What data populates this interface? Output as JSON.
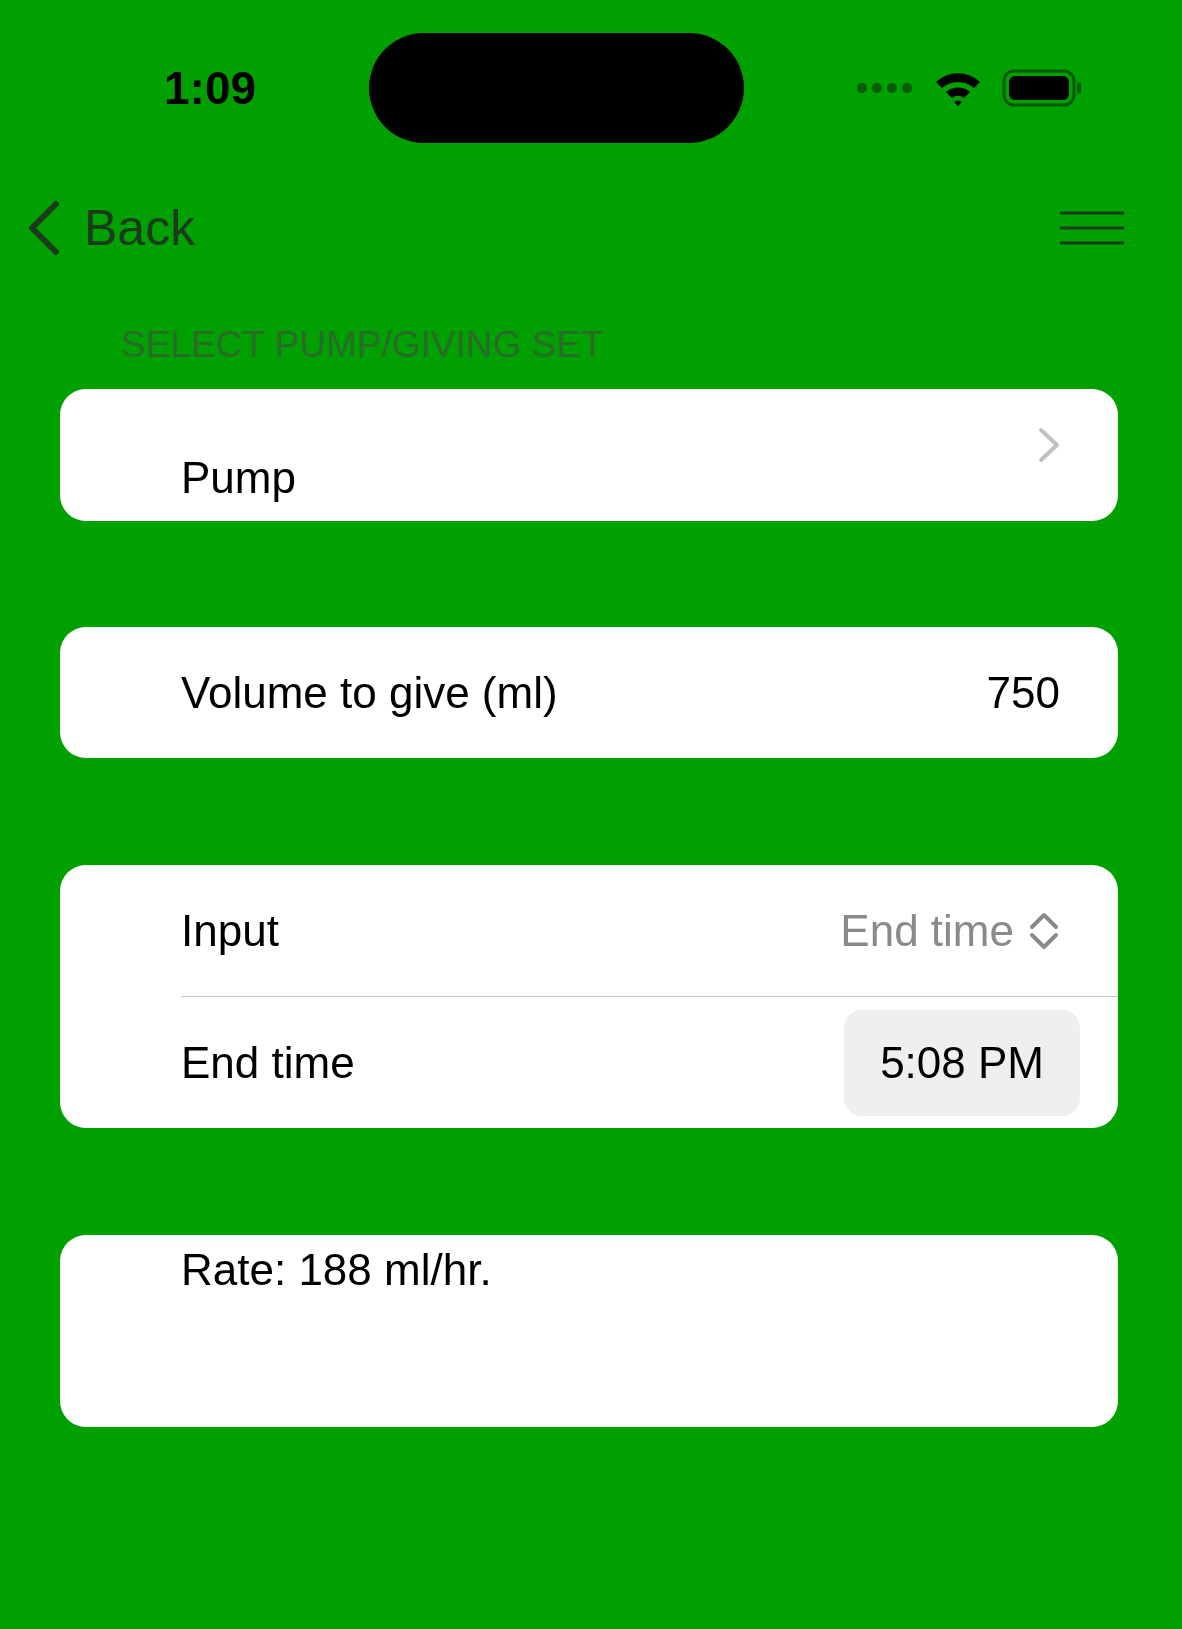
{
  "status_bar": {
    "time": "1:09"
  },
  "nav": {
    "back_label": "Back"
  },
  "pump_section": {
    "header": "SELECT PUMP/GIVING SET",
    "label": "Pump"
  },
  "volume": {
    "label": "Volume to give (ml)",
    "value": "750"
  },
  "input_group": {
    "rows": [
      {
        "kind": "picker",
        "label": "Input",
        "value": "End time"
      },
      {
        "kind": "time",
        "label": "End time",
        "value": "5:08 PM"
      }
    ]
  },
  "result": {
    "text": "Rate: 188 ml/hr."
  }
}
